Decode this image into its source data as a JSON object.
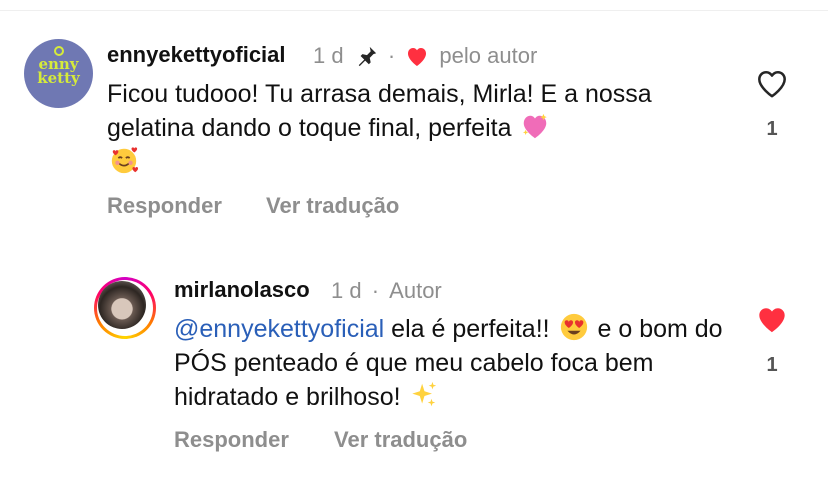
{
  "comment": {
    "avatar_logo_text_line1": "enny",
    "avatar_logo_text_line2": "ketty",
    "username": "ennyekettyoficial",
    "time": "1 d",
    "separator": "·",
    "liked_by_author_label": "pelo autor",
    "text": "Ficou tudooo! Tu arrasa demais, Mirla! E a nossa gelatina dando o toque final, perfeita",
    "emoji_1": "sparkling-heart",
    "emoji_2": "smiling-face-with-hearts",
    "reply_label": "Responder",
    "translate_label": "Ver tradução",
    "like_count": "1",
    "liked": false
  },
  "reply": {
    "username": "mirlanolasco",
    "time": "1 d",
    "separator": "·",
    "author_badge": "Autor",
    "mention": "@ennyekettyoficial",
    "text_part1": " ela é perfeita!! ",
    "text_part2": " e o bom do PÓS penteado é que meu cabelo foca bem hidratado e brilhoso! ",
    "emoji_1": "heart-eyes",
    "emoji_2": "sparkles",
    "reply_label": "Responder",
    "translate_label": "Ver tradução",
    "like_count": "1",
    "liked": true
  },
  "colors": {
    "like_red": "#ff3040",
    "mention_blue": "#2a5fb8",
    "muted_gray": "#8e8e8e",
    "brand_avatar_bg": "#6f78b3",
    "brand_logo_lime": "#d6eb3a"
  }
}
